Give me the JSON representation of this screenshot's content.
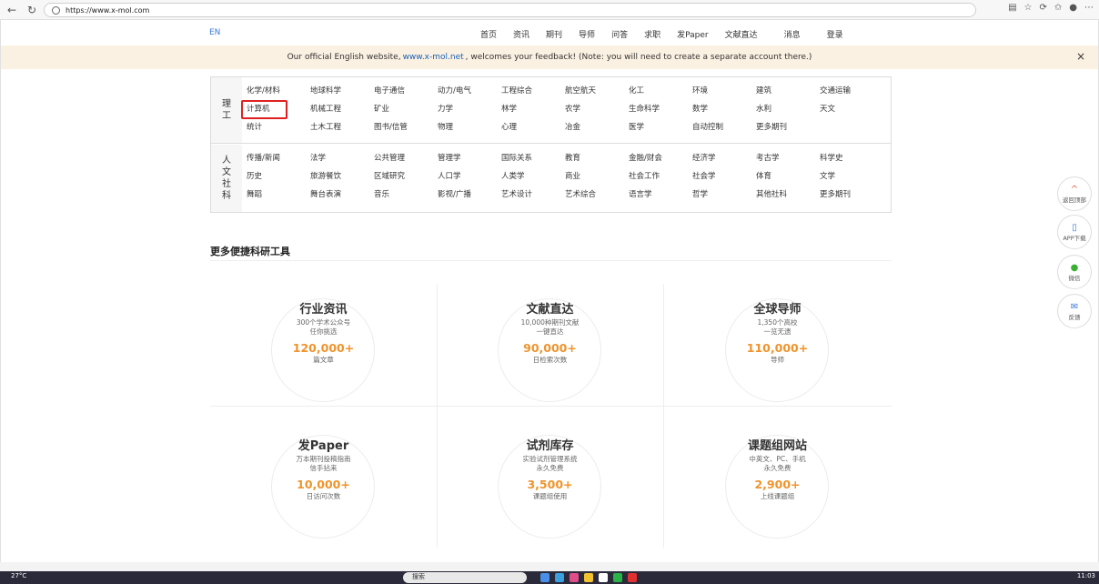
{
  "browser": {
    "url": "https://www.x-mol.com"
  },
  "nav": {
    "lang": "EN",
    "links": [
      "首页",
      "资讯",
      "期刊",
      "导师",
      "问答",
      "求职",
      "发Paper",
      "文献直达",
      "消息",
      "登录"
    ]
  },
  "notice": {
    "before": "Our official English website,",
    "link": "www.x-mol.net",
    "after": ", welcomes your feedback! (Note: you will need to create a separate account there.)",
    "close": "×"
  },
  "subjects": {
    "science": {
      "heading": [
        "理",
        "工"
      ],
      "items": [
        "化学/材料",
        "地球科学",
        "电子通信",
        "动力/电气",
        "工程综合",
        "航空航天",
        "化工",
        "环境",
        "建筑",
        "交通运输",
        "计算机",
        "机械工程",
        "矿业",
        "力学",
        "林学",
        "农学",
        "生命科学",
        "数学",
        "水利",
        "天文",
        "统计",
        "土木工程",
        "图书/信管",
        "物理",
        "心理",
        "冶金",
        "医学",
        "自动控制",
        "更多期刊"
      ]
    },
    "humanities": {
      "heading": [
        "人",
        "文",
        "社",
        "科"
      ],
      "items": [
        "传播/新闻",
        "法学",
        "公共管理",
        "管理学",
        "国际关系",
        "教育",
        "金融/财会",
        "经济学",
        "考古学",
        "科学史",
        "历史",
        "旅游餐饮",
        "区域研究",
        "人口学",
        "人类学",
        "商业",
        "社会工作",
        "社会学",
        "体育",
        "文学",
        "舞蹈",
        "舞台表演",
        "音乐",
        "影视/广播",
        "艺术设计",
        "艺术综合",
        "语言学",
        "哲学",
        "其他社科",
        "更多期刊"
      ]
    }
  },
  "tools": {
    "title": "更多便捷科研工具",
    "cards": [
      {
        "title": "行业资讯",
        "desc1": "300个学术公众号",
        "desc2": "任你挑选",
        "num": "120,000+",
        "unit": "篇文章"
      },
      {
        "title": "文献直达",
        "desc1": "10,000种期刊文献",
        "desc2": "一键直达",
        "num": "90,000+",
        "unit": "日检索次数"
      },
      {
        "title": "全球导师",
        "desc1": "1,350个高校",
        "desc2": "一览无遗",
        "num": "110,000+",
        "unit": "导师"
      },
      {
        "title": "发Paper",
        "desc1": "万本期刊投稿指南",
        "desc2": "信手拈来",
        "num": "10,000+",
        "unit": "日访问次数"
      },
      {
        "title": "试剂库存",
        "desc1": "实验试剂管理系统",
        "desc2": "永久免费",
        "num": "3,500+",
        "unit": "课题组使用"
      },
      {
        "title": "课题组网站",
        "desc1": "中英文、PC、手机",
        "desc2": "永久免费",
        "num": "2,900+",
        "unit": "上线课题组"
      }
    ]
  },
  "side": {
    "top": "返回顶部",
    "app": "APP下载",
    "wechat": "微信",
    "feedback": "反馈"
  },
  "taskbar": {
    "weather": "27°C",
    "search": "搜索",
    "time": "11:03"
  }
}
